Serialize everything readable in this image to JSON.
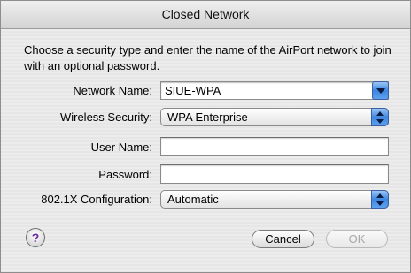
{
  "window": {
    "title": "Closed Network"
  },
  "description": "Choose a security type and enter the name of the AirPort network to join with an optional password.",
  "form": {
    "network_name": {
      "label": "Network Name:",
      "value": "SIUE-WPA"
    },
    "wireless_security": {
      "label": "Wireless Security:",
      "value": "WPA Enterprise"
    },
    "user_name": {
      "label": "User Name:",
      "value": ""
    },
    "password": {
      "label": "Password:",
      "value": ""
    },
    "config_8021x": {
      "label": "802.1X Configuration:",
      "value": "Automatic"
    }
  },
  "buttons": {
    "help": "?",
    "cancel": "Cancel",
    "ok": "OK"
  },
  "colors": {
    "accent": "#3d86e0",
    "help_glyph": "#6a2aa0"
  }
}
